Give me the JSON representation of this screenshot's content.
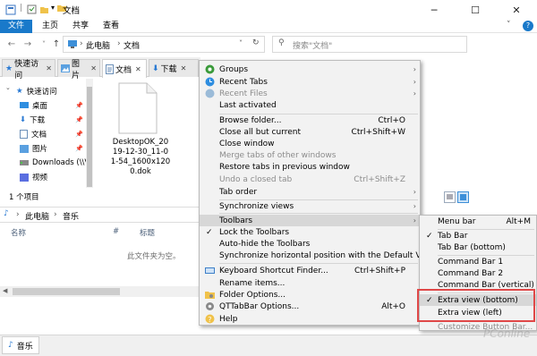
{
  "titlebar": {
    "title": "文档",
    "buttons": [
      "─",
      "☐",
      "✕"
    ]
  },
  "ribbon": {
    "tabs": [
      "文件",
      "主页",
      "共享",
      "查看"
    ],
    "expand": "˅",
    "help": "?"
  },
  "address": {
    "crumbs": [
      "此电脑",
      "文档"
    ],
    "search_placeholder": "搜索\"文档\""
  },
  "qt_tabs": [
    {
      "label": "快速访问"
    },
    {
      "label": "图片"
    },
    {
      "label": "文档"
    },
    {
      "label": "下载"
    }
  ],
  "nav_pane": {
    "items": [
      {
        "label": "快速访问"
      },
      {
        "label": "桌面"
      },
      {
        "label": "下载"
      },
      {
        "label": "文档"
      },
      {
        "label": "图片"
      },
      {
        "label": "Downloads (\\\\V"
      },
      {
        "label": "视频"
      }
    ]
  },
  "file": {
    "name_lines": [
      "DesktopOK_20",
      "19-12-30_11-0",
      "1-54_1600x120",
      "0.dok"
    ]
  },
  "status": {
    "count": "1 个项目"
  },
  "pane2": {
    "crumbs": [
      "此电脑",
      "音乐"
    ],
    "columns": [
      "名称",
      "#",
      "标题"
    ],
    "empty_text": "此文件夹为空。",
    "bottom_tab": "音乐"
  },
  "context_menu": {
    "items": [
      {
        "label": "Groups",
        "arrow": "›"
      },
      {
        "label": "Recent Tabs",
        "arrow": "›"
      },
      {
        "label": "Recent Files",
        "arrow": "›",
        "disabled": true
      },
      {
        "label": "Last activated"
      },
      {
        "sep": true
      },
      {
        "label": "Browse folder...",
        "shortcut": "Ctrl+O"
      },
      {
        "label": "Close all but current",
        "shortcut": "Ctrl+Shift+W"
      },
      {
        "label": "Close window"
      },
      {
        "label": "Merge tabs of other windows",
        "disabled": true
      },
      {
        "label": "Restore tabs in previous window"
      },
      {
        "label": "Undo a closed tab",
        "shortcut": "Ctrl+Shift+Z",
        "disabled": true
      },
      {
        "label": "Tab order",
        "arrow": "›"
      },
      {
        "sep": true
      },
      {
        "label": "Synchronize views",
        "arrow": "›"
      },
      {
        "sep": true
      },
      {
        "label": "Toolbars",
        "arrow": "›",
        "highlighted": true
      },
      {
        "label": "Lock the Toolbars",
        "checked": true
      },
      {
        "label": "Auto-hide the Toolbars"
      },
      {
        "label": "Synchronize horizontal position with the Default View"
      },
      {
        "sep": true
      },
      {
        "label": "Keyboard Shortcut Finder...",
        "shortcut": "Ctrl+Shift+P"
      },
      {
        "label": "Rename items..."
      },
      {
        "label": "Folder Options..."
      },
      {
        "label": "QTTabBar Options...",
        "shortcut": "Alt+O"
      },
      {
        "label": "Help"
      }
    ]
  },
  "submenu": {
    "items": [
      {
        "label": "Menu bar",
        "shortcut": "Alt+M"
      },
      {
        "sep": true
      },
      {
        "label": "Tab Bar",
        "checked": true
      },
      {
        "label": "Tab Bar (bottom)"
      },
      {
        "sep": true
      },
      {
        "label": "Command Bar 1"
      },
      {
        "label": "Command Bar 2"
      },
      {
        "label": "Command Bar (vertical)"
      },
      {
        "sep": true
      },
      {
        "label": "Extra view (bottom)",
        "checked": true
      },
      {
        "label": "Extra view (left)"
      },
      {
        "sep": true
      },
      {
        "label": "Customize Button Bar...",
        "disabled": true
      }
    ]
  },
  "watermark": "PConline",
  "colors": {
    "accent": "#1979ca",
    "highlight_box": "#e04848",
    "folder": "#f0c24a"
  }
}
